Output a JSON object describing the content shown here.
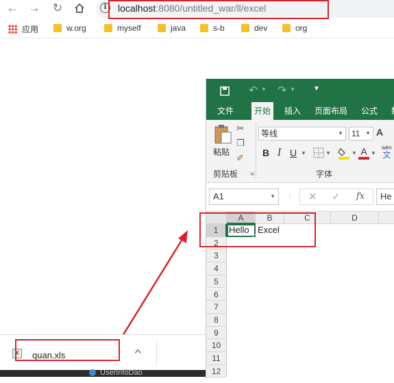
{
  "browser": {
    "url_host": "localhost",
    "url_rest": ":8080/untitled_war/ll/excel",
    "info_glyph": "i"
  },
  "bookmarks": {
    "apps_label": "应用",
    "items": [
      "w.org",
      "myself",
      "java",
      "s-b",
      "dev",
      "org"
    ]
  },
  "excel": {
    "tabs": [
      "文件",
      "开始",
      "插入",
      "页面布局",
      "公式",
      "数"
    ],
    "active_tab": "开始",
    "clipboard": {
      "paste_label": "粘贴",
      "group_label": "剪贴板"
    },
    "font": {
      "name": "等线",
      "size": "11",
      "group_label": "字体",
      "bold": "B",
      "italic": "I",
      "underline": "U",
      "grow": "A",
      "wen": "wén",
      "wen_char": "文"
    },
    "formula_bar": {
      "name_box": "A1",
      "fx": "fx",
      "content": "He"
    },
    "columns": [
      "A",
      "B",
      "C",
      "D"
    ],
    "rows": [
      "1",
      "2",
      "3",
      "4",
      "5",
      "6",
      "7",
      "8",
      "9",
      "10",
      "11",
      "12"
    ],
    "cells": {
      "A1": "Hello",
      "B1": "Excel"
    }
  },
  "download": {
    "filename": "quan.xls",
    "chevron": "^"
  },
  "taskbar": {
    "peek_text": "UserInfoDao"
  },
  "colors": {
    "excel_green": "#217346",
    "highlight_red": "#d4242b"
  }
}
